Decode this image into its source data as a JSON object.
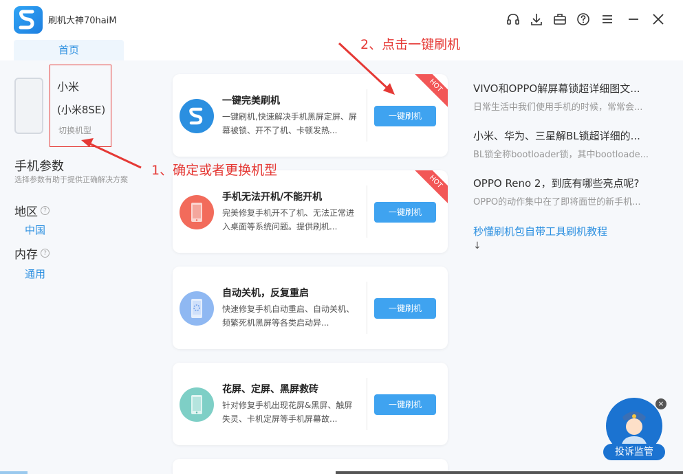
{
  "app": {
    "title": "刷机大神70haiM"
  },
  "tabs": [
    {
      "label": "首页"
    }
  ],
  "device": {
    "name": "小米",
    "model": "(小米8SE)",
    "switch_label": "切换机型"
  },
  "params": {
    "title": "手机参数",
    "hint": "选择参数有助于提供正确解决方案",
    "region": {
      "label": "地区",
      "value": "中国"
    },
    "memory": {
      "label": "内存",
      "value": "通用"
    }
  },
  "cards": [
    {
      "title": "一键完美刷机",
      "desc": "一键刷机,快速解决手机黑屏定屏、屏幕被锁、开不了机、卡顿发热...",
      "button": "一键刷机",
      "hot": "HOT",
      "icon": "lightning-s-icon",
      "color": "#2b8fe0"
    },
    {
      "title": "手机无法开机/不能开机",
      "desc": "完美修复手机开不了机、无法正常进入桌面等系统问题。提供刷机...",
      "button": "一键刷机",
      "hot": "HOT",
      "icon": "phone-power-icon",
      "color": "#f26b5b"
    },
    {
      "title": "自动关机，反复重启",
      "desc": "快速修复手机自动重启、自动关机、频繁死机黑屏等各类启动异...",
      "button": "一键刷机",
      "hot": "",
      "icon": "phone-loading-icon",
      "color": "#8fb8f2"
    },
    {
      "title": "花屏、定屏、黑屏救砖",
      "desc": "针对修复手机出现花屏&黑屏、触屏失灵、卡机定屏等手机屏幕故...",
      "button": "一键刷机",
      "hot": "",
      "icon": "phone-screen-icon",
      "color": "#7ecfc6"
    }
  ],
  "news": [
    {
      "title": "VIVO和OPPO解屏幕锁超详细图文...",
      "sub": "日常生活中我们使用手机的时候，常常会..."
    },
    {
      "title": "小米、华为、三星解BL锁超详细的...",
      "sub": "BL锁全称bootloader锁，其中bootloade..."
    },
    {
      "title": "OPPO Reno 2，到底有哪些亮点呢?",
      "sub": "OPPO的动作集中在了即将面世的新手机..."
    }
  ],
  "tutorial_link": "秒懂刷机包自带工具刷机教程",
  "down_arrow": "↓",
  "annotations": {
    "step1": "1、确定或者更换机型",
    "step2": "2、点击一键刷机",
    "color": "#e53935"
  },
  "complaint": {
    "label": "投诉监管",
    "close": "×"
  },
  "colors": {
    "accent": "#2b8fe0",
    "button": "#3fa3f0",
    "hot": "#f25757"
  }
}
